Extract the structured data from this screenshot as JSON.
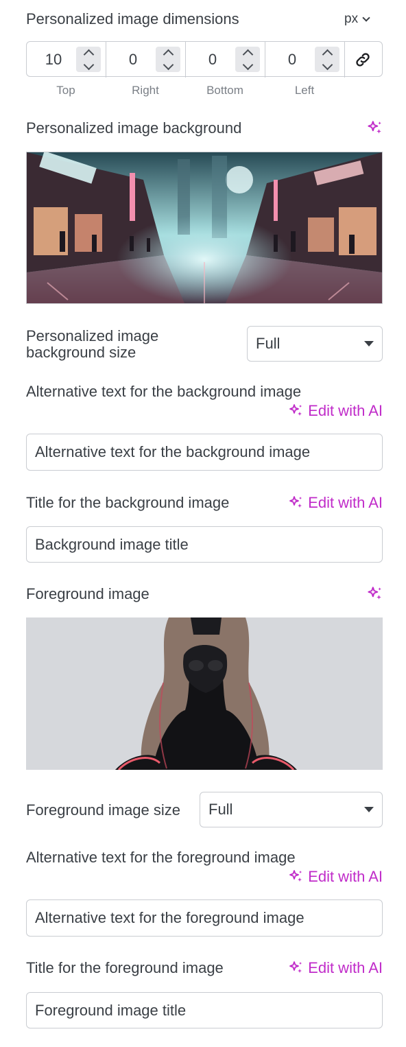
{
  "dimensions": {
    "title": "Personalized image dimensions",
    "unit": "px",
    "values": [
      "10",
      "0",
      "0",
      "0"
    ],
    "labels": [
      "Top",
      "Right",
      "Bottom",
      "Left"
    ]
  },
  "background": {
    "title": "Personalized image background",
    "image_alt": "Cyberpunk neon city street",
    "size_label": "Personalized image background size",
    "size_value": "Full",
    "alt_label": "Alternative text for the background image",
    "alt_edit": "Edit with AI",
    "alt_placeholder": "Alternative text for the background image",
    "title_label": "Title for the background image",
    "title_edit": "Edit with AI",
    "title_placeholder": "Background image title"
  },
  "foreground": {
    "title": "Foreground image",
    "image_alt": "Cyberpunk figure in black latex suit",
    "size_label": "Foreground image size",
    "size_value": "Full",
    "alt_label": "Alternative text for the foreground image",
    "alt_edit": "Edit with AI",
    "alt_placeholder": "Alternative text for the foreground image",
    "title_label": "Title for the foreground image",
    "title_edit": "Edit with AI",
    "title_placeholder": "Foreground image title"
  },
  "colors": {
    "accent": "#c02bc9",
    "text": "#3a3f45",
    "border": "#c9ccd1",
    "image_bg": "#d6d8dc"
  }
}
